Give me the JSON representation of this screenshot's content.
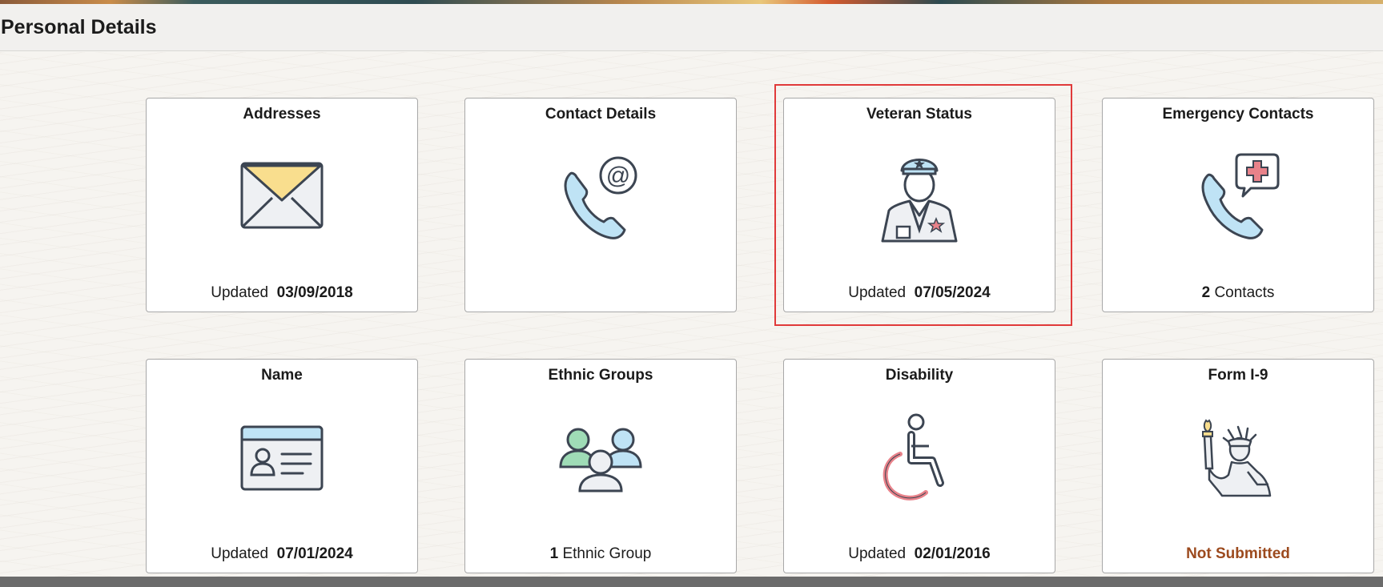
{
  "header": {
    "title": "Personal Details"
  },
  "tiles": [
    {
      "id": "addresses",
      "title": "Addresses",
      "icon": "envelope-icon",
      "footer_prefix": "Updated",
      "footer_value": "03/09/2018"
    },
    {
      "id": "contact_details",
      "title": "Contact Details",
      "icon": "phone-at-icon"
    },
    {
      "id": "veteran_status",
      "title": "Veteran Status",
      "icon": "officer-icon",
      "footer_prefix": "Updated",
      "footer_value": "07/05/2024",
      "highlighted": true
    },
    {
      "id": "emergency_contacts",
      "title": "Emergency Contacts",
      "icon": "phone-medical-icon",
      "footer_count": "2",
      "footer_suffix": "Contacts"
    },
    {
      "id": "name",
      "title": "Name",
      "icon": "id-card-icon",
      "footer_prefix": "Updated",
      "footer_value": "07/01/2024"
    },
    {
      "id": "ethnic_groups",
      "title": "Ethnic Groups",
      "icon": "people-group-icon",
      "footer_count": "1",
      "footer_suffix": "Ethnic Group"
    },
    {
      "id": "disability",
      "title": "Disability",
      "icon": "wheelchair-icon",
      "footer_prefix": "Updated",
      "footer_value": "02/01/2016"
    },
    {
      "id": "form_i9",
      "title": "Form I-9",
      "icon": "statue-of-liberty-icon",
      "footer_status": "Not Submitted"
    }
  ],
  "colors": {
    "highlight_border": "#e03a3a",
    "status_not_submitted": "#9c4a1e",
    "icon_light_blue": "#bfe3f5",
    "icon_yellow": "#f9de8e",
    "icon_green": "#9fdcb6",
    "icon_red": "#e8828a",
    "icon_outline": "#3c4552"
  }
}
